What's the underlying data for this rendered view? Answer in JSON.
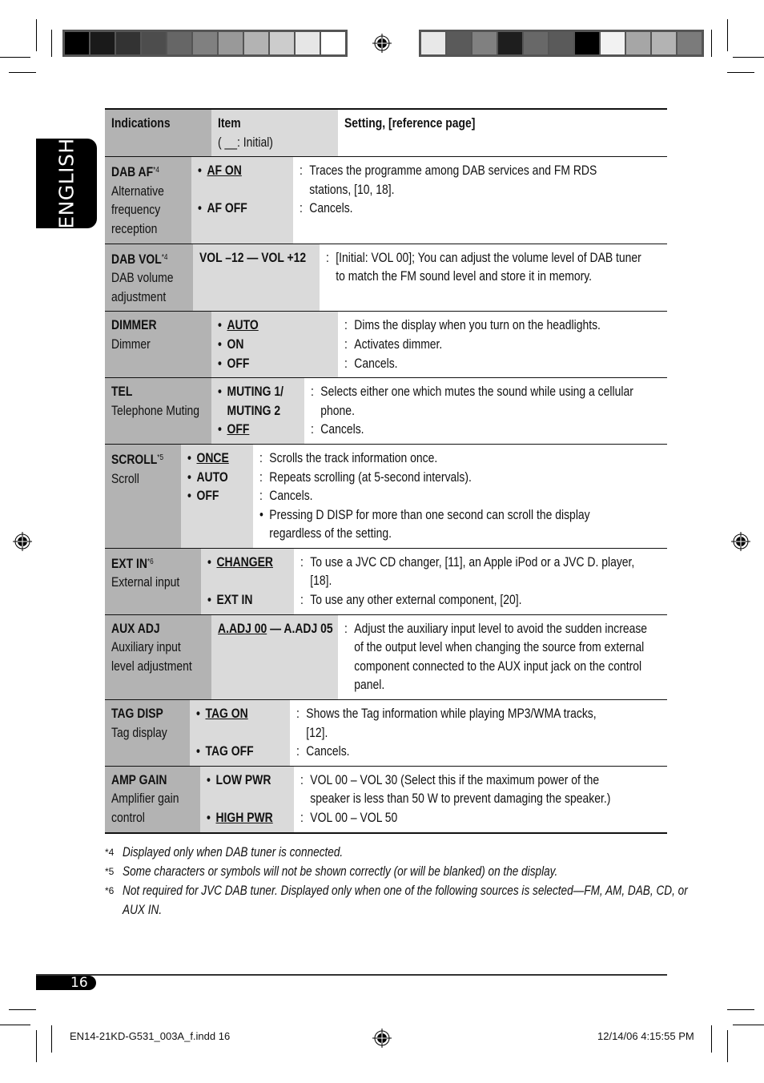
{
  "printer_marks": {
    "left_swatches": [
      "#000000",
      "#1a1a1a",
      "#333333",
      "#4d4d4d",
      "#666666",
      "#808080",
      "#999999",
      "#b3b3b3",
      "#cccccc",
      "#e6e6e6",
      "#ffffff"
    ],
    "right_swatches": [
      "#e8e8e8",
      "#5a5a5a",
      "#808080",
      "#1e1e1e",
      "#686868",
      "#5a5a5a",
      "#000000",
      "#f2f2f2",
      "#a6a6a6",
      "#b3b3b3",
      "#7b7b7b"
    ]
  },
  "language_tab": "ENGLISH",
  "table": {
    "headers": {
      "indications": "Indications",
      "item": "Item",
      "item_note": "( __: Initial)",
      "setting": "Setting, [reference page]"
    },
    "rows": [
      {
        "name": "DAB AF",
        "footnote": "*4",
        "desc": [
          "Alternative",
          "frequency",
          "reception"
        ],
        "items": [
          {
            "label": "AF ON",
            "initial": true,
            "bullet": true
          },
          {
            "label": "",
            "bullet": false
          },
          {
            "label": "AF OFF",
            "initial": false,
            "bullet": true
          }
        ],
        "settings": [
          {
            "prefix": ":",
            "text": "Traces the programme among DAB services and FM RDS"
          },
          {
            "prefix": "",
            "text": "stations, [10, 18]."
          },
          {
            "prefix": ":",
            "text": "Cancels."
          }
        ]
      },
      {
        "name": "DAB VOL",
        "footnote": "*4",
        "desc": [
          "DAB volume",
          "adjustment"
        ],
        "items": [
          {
            "label": "VOL –12 — VOL +12",
            "initial": false,
            "bullet": false
          }
        ],
        "settings": [
          {
            "prefix": ":",
            "text": "[Initial: VOL 00]; You can adjust the volume level of DAB tuner"
          },
          {
            "prefix": "",
            "text": "to match the FM sound level and store it in memory."
          }
        ]
      },
      {
        "name": "DIMMER",
        "footnote": "",
        "desc": [
          "Dimmer"
        ],
        "items": [
          {
            "label": "AUTO",
            "initial": true,
            "bullet": true
          },
          {
            "label": "ON",
            "initial": false,
            "bullet": true
          },
          {
            "label": "OFF",
            "initial": false,
            "bullet": true
          }
        ],
        "settings": [
          {
            "prefix": ":",
            "text": "Dims the display when you turn on the headlights."
          },
          {
            "prefix": ":",
            "text": "Activates dimmer."
          },
          {
            "prefix": ":",
            "text": "Cancels."
          }
        ]
      },
      {
        "name": "TEL",
        "footnote": "",
        "desc": [
          "Telephone Muting"
        ],
        "items": [
          {
            "label": "MUTING 1/",
            "initial": false,
            "bullet": true
          },
          {
            "label": "MUTING 2",
            "initial": false,
            "bullet": false,
            "indent": true
          },
          {
            "label": "OFF",
            "initial": true,
            "bullet": true
          }
        ],
        "settings": [
          {
            "prefix": ":",
            "text": "Selects either one which mutes the sound while using a cellular"
          },
          {
            "prefix": "",
            "text": "phone."
          },
          {
            "prefix": ":",
            "text": "Cancels."
          }
        ]
      },
      {
        "name": "SCROLL",
        "footnote": "*5",
        "desc": [
          "Scroll"
        ],
        "items": [
          {
            "label": "ONCE",
            "initial": true,
            "bullet": true
          },
          {
            "label": "AUTO",
            "initial": false,
            "bullet": true
          },
          {
            "label": "OFF",
            "initial": false,
            "bullet": true
          }
        ],
        "settings": [
          {
            "prefix": ":",
            "text": "Scrolls the track information once."
          },
          {
            "prefix": ":",
            "text": "Repeats scrolling (at 5-second intervals)."
          },
          {
            "prefix": ":",
            "text": "Cancels."
          },
          {
            "prefix": "•",
            "text": "Pressing D DISP for more than one second can scroll the display"
          },
          {
            "prefix": "",
            "text": "regardless of the setting."
          }
        ]
      },
      {
        "name": "EXT IN",
        "footnote": "*6",
        "desc": [
          "External input"
        ],
        "items": [
          {
            "label": "CHANGER",
            "initial": true,
            "bullet": true
          },
          {
            "label": "",
            "bullet": false
          },
          {
            "label": "EXT IN",
            "initial": false,
            "bullet": true
          }
        ],
        "settings": [
          {
            "prefix": ":",
            "text": "To use a JVC CD changer, [11], an Apple iPod or a JVC D. player,"
          },
          {
            "prefix": "",
            "text": "[18]."
          },
          {
            "prefix": ":",
            "text": "To use any other external component, [20]."
          }
        ]
      },
      {
        "name": "AUX ADJ",
        "footnote": "",
        "desc": [
          "Auxiliary input",
          "level adjustment"
        ],
        "items": [
          {
            "label": "A.ADJ 00",
            "initial": true,
            "bullet": false,
            "suffix": " — A.ADJ 05"
          }
        ],
        "settings": [
          {
            "prefix": ":",
            "text": "Adjust the auxiliary input level to avoid the sudden increase"
          },
          {
            "prefix": "",
            "text": "of the output level when changing the source from external"
          },
          {
            "prefix": "",
            "text": "component connected to the AUX input jack on the control"
          },
          {
            "prefix": "",
            "text": "panel."
          }
        ]
      },
      {
        "name": "TAG DISP",
        "footnote": "",
        "desc": [
          "Tag display"
        ],
        "items": [
          {
            "label": "TAG ON",
            "initial": true,
            "bullet": true
          },
          {
            "label": "",
            "bullet": false
          },
          {
            "label": "TAG OFF",
            "initial": false,
            "bullet": true
          }
        ],
        "settings": [
          {
            "prefix": ":",
            "text": "Shows the Tag information while playing MP3/WMA tracks,"
          },
          {
            "prefix": "",
            "text": "[12]."
          },
          {
            "prefix": ":",
            "text": "Cancels."
          }
        ]
      },
      {
        "name": "AMP GAIN",
        "footnote": "",
        "desc": [
          "Amplifier gain",
          "control"
        ],
        "items": [
          {
            "label": "LOW PWR",
            "initial": false,
            "bullet": true
          },
          {
            "label": "",
            "bullet": false
          },
          {
            "label": "HIGH PWR",
            "initial": true,
            "bullet": true
          }
        ],
        "settings": [
          {
            "prefix": ":",
            "text": "VOL 00 – VOL 30 (Select this if the maximum power of the"
          },
          {
            "prefix": "",
            "text": "speaker is less than 50 W to prevent damaging the speaker.)"
          },
          {
            "prefix": ":",
            "text": "VOL 00 – VOL 50"
          }
        ]
      }
    ]
  },
  "footnotes": [
    {
      "mark": "*4",
      "lines": [
        "Displayed only when DAB tuner is connected."
      ]
    },
    {
      "mark": "*5",
      "lines": [
        "Some characters or symbols will not be shown correctly (or will be blanked) on the display."
      ]
    },
    {
      "mark": "*6",
      "lines": [
        "Not required for JVC DAB tuner. Displayed only when one of the following sources is selected—FM, AM, DAB, CD, or",
        "AUX IN."
      ]
    }
  ],
  "page_number": "16",
  "slug": {
    "file": "EN14-21KD-G531_003A_f.indd   16",
    "datetime": "12/14/06   4:15:55 PM"
  }
}
